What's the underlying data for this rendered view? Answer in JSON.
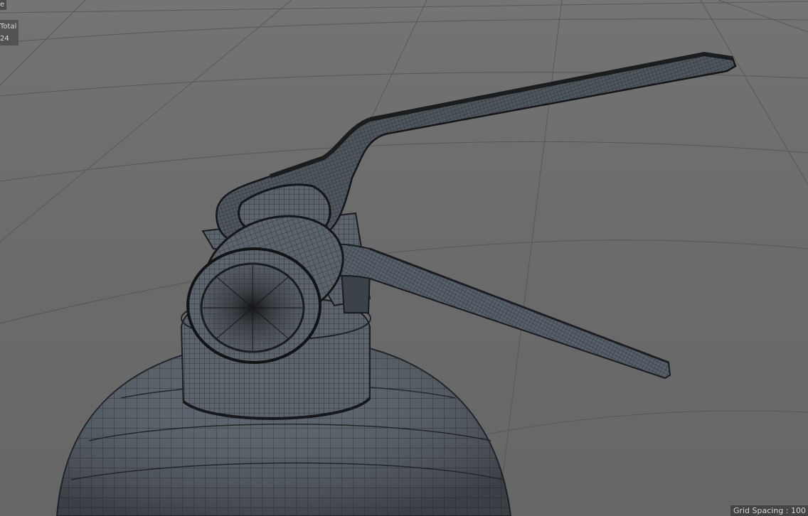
{
  "viewport": {
    "title_fragment": "e",
    "stats": {
      "header": "Total",
      "value": "24"
    },
    "grid_spacing_text": "Grid Spacing : 100"
  },
  "scene": {
    "object": "fire-extinguisher-wireframe",
    "colors": {
      "background": "#6e6e6e",
      "grid_line": "#575757",
      "mesh_fill": "#5a636b",
      "mesh_wire": "#26292c",
      "lever_fill": "#4a5158"
    }
  }
}
